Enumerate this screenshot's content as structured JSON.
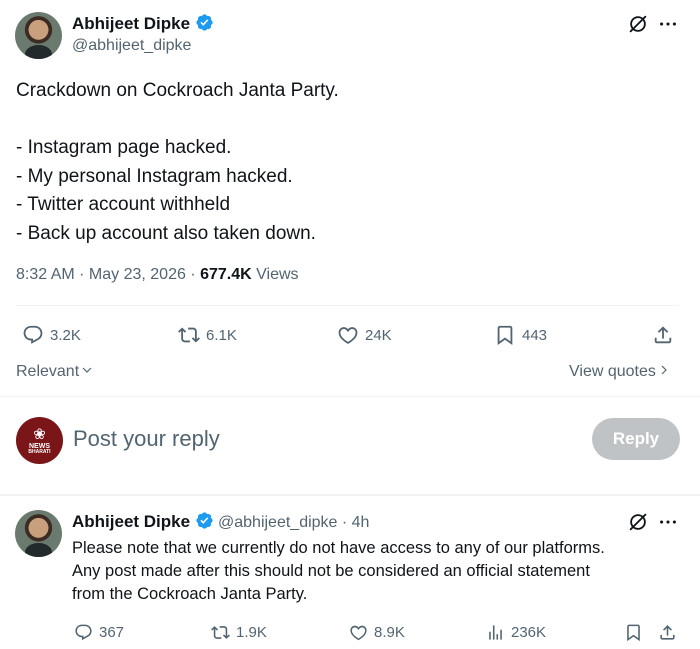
{
  "main_tweet": {
    "author_name": "Abhijeet Dipke",
    "author_handle": "@abhijeet_dipke",
    "text": "Crackdown on Cockroach Janta Party.\n\n- Instagram page hacked.\n- My personal Instagram hacked.\n- Twitter account withheld\n- Back up account also taken down.",
    "time": "8:32 AM · May 23, 2026 · ",
    "views_count": "677.4K",
    "views_label": " Views",
    "replies": "3.2K",
    "reposts": "6.1K",
    "likes": "24K",
    "bookmarks": "443"
  },
  "sort": {
    "label": "Relevant",
    "view_quotes": "View quotes"
  },
  "composer": {
    "placeholder": "Post your reply",
    "reply_button": "Reply",
    "avatar_logo_line1": "NEWS",
    "avatar_logo_line2": "BHARATI"
  },
  "reply_tweet": {
    "author_name": "Abhijeet Dipke",
    "author_handle": "@abhijeet_dipke",
    "age": " · 4h",
    "text": "Please note that we currently do not have access to any of our platforms.\nAny post made after this should not be considered an official statement\nfrom the Cockroach Janta Party.",
    "replies": "367",
    "reposts": "1.9K",
    "likes": "8.9K",
    "views": "236K"
  },
  "colors": {
    "accent": "#1d9bf0",
    "muted": "#536471",
    "divider": "#eff3f4"
  }
}
